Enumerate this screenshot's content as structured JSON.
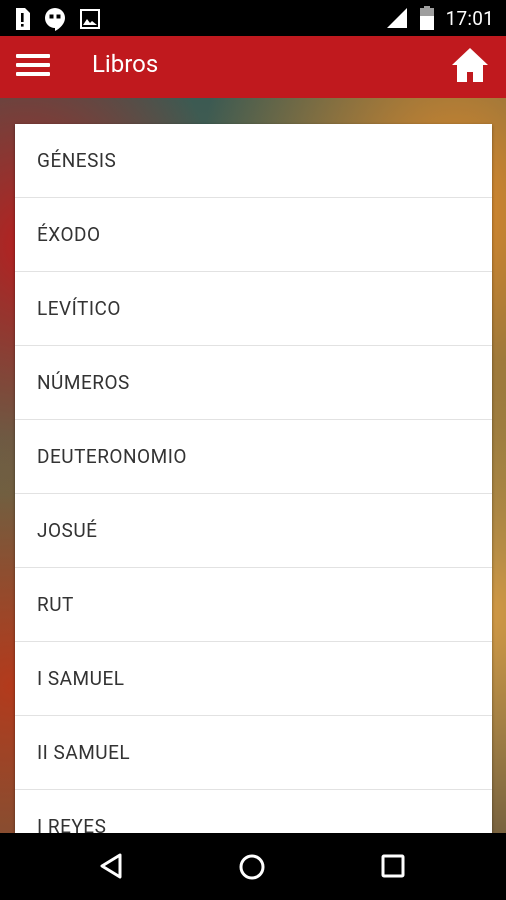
{
  "status_bar": {
    "time": "17:01",
    "icons": [
      "sim-alert-icon",
      "hangouts-icon",
      "image-icon",
      "signal-icon",
      "battery-icon"
    ]
  },
  "app_bar": {
    "title": "Libros",
    "color": "#c0191e",
    "menu_icon": "hamburger-menu-icon",
    "home_icon": "home-icon"
  },
  "books": [
    {
      "label": "GÉNESIS"
    },
    {
      "label": "ÉXODO"
    },
    {
      "label": "LEVÍTICO"
    },
    {
      "label": "NÚMEROS"
    },
    {
      "label": "DEUTERONOMIO"
    },
    {
      "label": "JOSUÉ"
    },
    {
      "label": "RUT"
    },
    {
      "label": "I SAMUEL"
    },
    {
      "label": "II SAMUEL"
    },
    {
      "label": "I REYES"
    }
  ],
  "nav_bar": {
    "back_icon": "back-triangle-icon",
    "home_icon": "home-circle-icon",
    "recents_icon": "recents-square-icon"
  }
}
